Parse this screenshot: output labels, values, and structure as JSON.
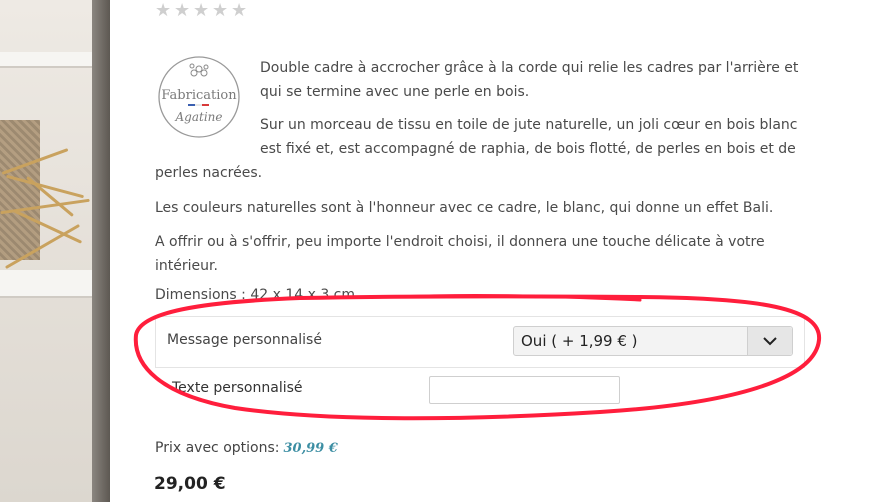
{
  "rating": {
    "stars": 5,
    "filled": 0
  },
  "logo": {
    "line1": "Fabrication",
    "line2": "Agatine"
  },
  "description": {
    "p1": "Double cadre à accrocher grâce à la corde qui relie les cadres par l'arrière et qui se termine avec une perle en bois.",
    "p2_part1": "Sur un morceau de tissu en toile de jute naturelle, un joli cœur en bois blanc est fixé et, est accompagné de raphia, de bois flotté, de perles en bois et de",
    "p2_part2": "perles nacrées.",
    "p3": "Les couleurs naturelles sont à l'honneur avec ce cadre, le blanc, qui donne un effet Bali.",
    "p4": "A offrir ou à s'offrir, peu importe l'endroit choisi, il donnera une touche délicate à votre intérieur.",
    "dimensions": "Dimensions : 42 x 14 x 3 cm"
  },
  "options": {
    "message_label": "Message personnalisé",
    "message_selected": "Oui ( + 1,99 € )",
    "text_label": "Texte personnalisé",
    "text_value": ""
  },
  "pricing": {
    "with_options_label": "Prix avec options:",
    "with_options_value": "30,99 €",
    "price": "29,00 €"
  },
  "colors": {
    "annotation": "#ff1e3c",
    "price_options": "#3c8ea3"
  }
}
